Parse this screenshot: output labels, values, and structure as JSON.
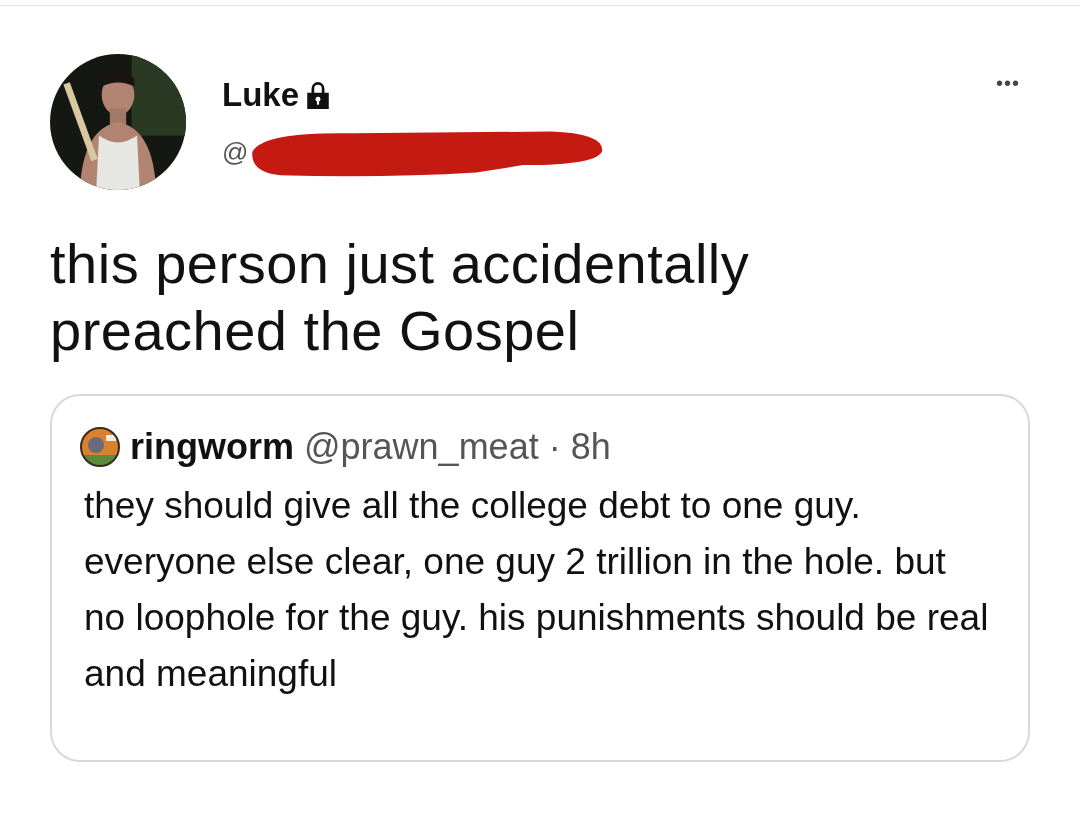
{
  "author": {
    "name": "Luke",
    "protected": true,
    "handle_visible": "@",
    "handle_redacted": true
  },
  "more_menu": "•••",
  "text": "this person just accidentally preached the Gospel",
  "quoted": {
    "name": "ringworm",
    "handle": "@prawn_meat",
    "separator": "·",
    "time": "8h",
    "text": "they should give all the college debt to one guy. everyone else clear, one guy 2 trillion in the hole. but no loophole for the guy. his punishments should be real and meaningful"
  }
}
